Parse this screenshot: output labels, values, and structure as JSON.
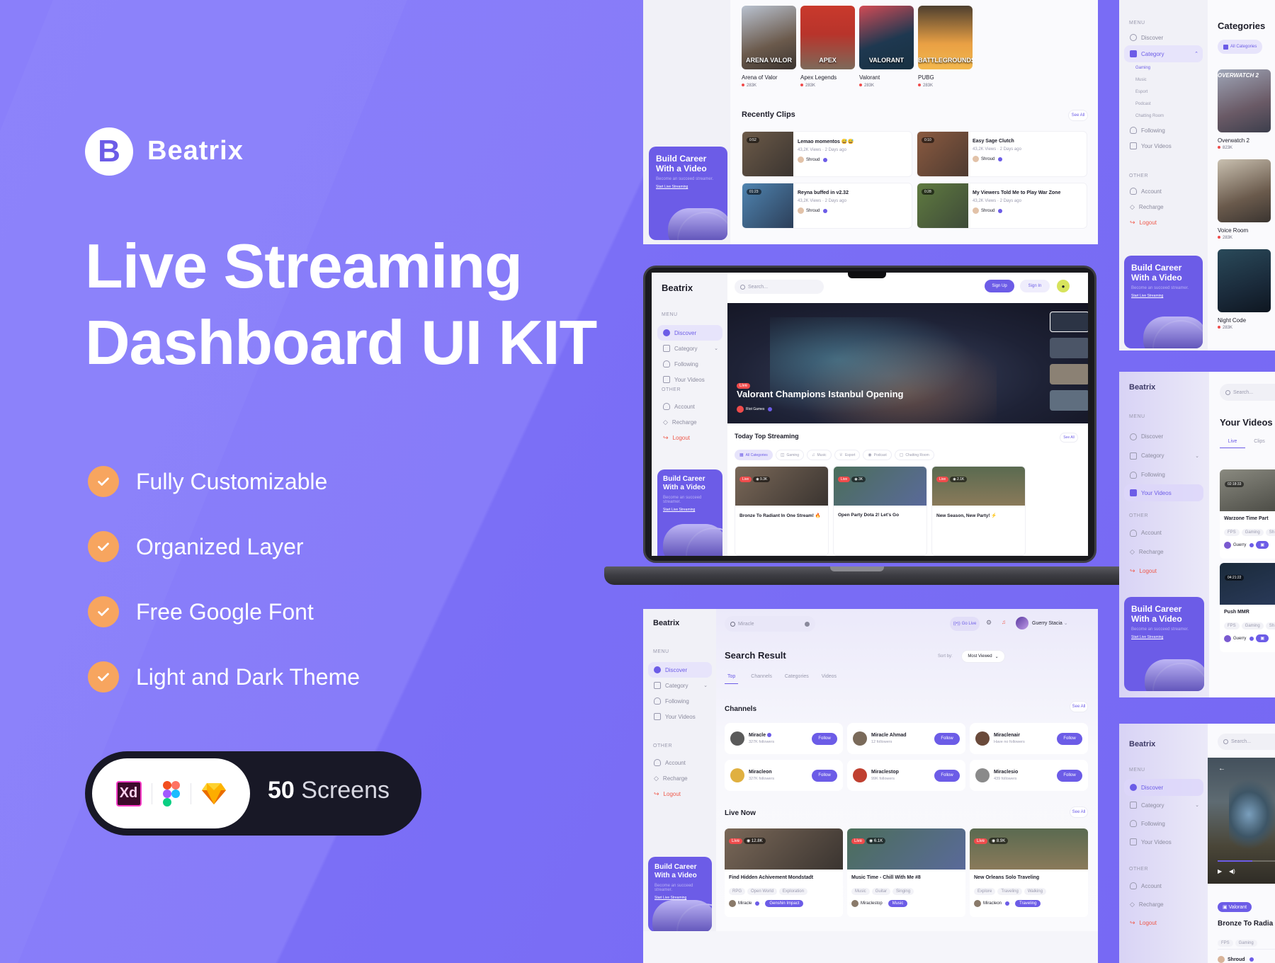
{
  "hero": {
    "logo_letter": "B",
    "brand": "Beatrix",
    "title_line1": "Live Streaming",
    "title_line2": "Dashboard UI KIT",
    "features": [
      "Fully Customizable",
      "Organized Layer",
      "Free Google Font",
      "Light and Dark Theme"
    ],
    "badge": {
      "tools": [
        "Adobe XD",
        "Figma",
        "Sketch"
      ],
      "xd_label": "Xd",
      "count": "50",
      "label": " Screens"
    }
  },
  "colors": {
    "accent": "#6c5ce7",
    "background": "#7c6ff6",
    "check": "#f7a55f",
    "live": "#ef4b4b",
    "badge_bg": "#181826"
  },
  "sidebar": {
    "brand": "Beatrix",
    "menu_label": "MENU",
    "other_label": "OTHER",
    "items": [
      "Discover",
      "Category",
      "Following",
      "Your Videos"
    ],
    "category_sub": [
      "Gaming",
      "Music",
      "Esport",
      "Podcast",
      "Chatting Room"
    ],
    "other_items": [
      "Account",
      "Recharge",
      "Logout"
    ],
    "career": {
      "title1": "Build Career",
      "title2": "With a Video",
      "subtitle": "Become an succeed streamer.",
      "link": "Start Live Streaming"
    }
  },
  "panel_top": {
    "games": [
      {
        "name": "Arena of Valor",
        "viewers": "283K",
        "art": "ARENA VALOR"
      },
      {
        "name": "Apex Legends",
        "viewers": "283K",
        "art": "APEX"
      },
      {
        "name": "Valorant",
        "viewers": "283K",
        "art": "VALORANT"
      },
      {
        "name": "PUBG",
        "viewers": "283K",
        "art": "BATTLEGROUNDS"
      }
    ],
    "clips_title": "Recently Clips",
    "see_all": "See All",
    "clips": [
      {
        "duration": "0:52",
        "title": "Lemao momentos 😅😅",
        "views": "43,2K Views",
        "ago": "2 Days ago",
        "author": "Shroud"
      },
      {
        "duration": "0:10",
        "title": "Easy Sage Clutch",
        "views": "43,2K Views",
        "ago": "2 Days ago",
        "author": "Shroud"
      },
      {
        "duration": "01:23",
        "title": "Reyna buffed in v2.32",
        "views": "43,2K Views",
        "ago": "2 Days ago",
        "author": "Shroud"
      },
      {
        "duration": "0:28",
        "title": "My Viewers Told Me to Play War Zone",
        "views": "43,2K Views",
        "ago": "2 Days ago",
        "author": "Shroud"
      }
    ]
  },
  "laptop": {
    "search_placeholder": "Search...",
    "signup": "Sign Up",
    "signin": "Sign In",
    "hero_live": "Live",
    "hero_title": "Valorant Champions Istanbul Opening",
    "hero_channel": "Riot Games",
    "section_title": "Today Top Streaming",
    "see_all": "See All",
    "categories": [
      "All Categories",
      "Gaming",
      "Music",
      "Esport",
      "Podcast",
      "Chatting Room"
    ],
    "streams": [
      {
        "live": "Live",
        "viewers": "9.3K",
        "title": "Bronze To Radiant In One Stream! 🔥"
      },
      {
        "live": "Live",
        "viewers": "3K",
        "title": "Open Party Dota 2! Let's Go"
      },
      {
        "live": "Live",
        "viewers": "2.1K",
        "title": "New Season, New Party! ⚡"
      }
    ]
  },
  "panel_search": {
    "search_value": "Miracle",
    "go_live": "Go Live",
    "user": "Guerry Stacia",
    "title": "Search Result",
    "sort_label": "Sort by:",
    "sort_value": "Most Viewed",
    "tabs": [
      "Top",
      "Channels",
      "Categories",
      "Videos"
    ],
    "channels_title": "Channels",
    "see_all": "See All",
    "follow": "Follow",
    "channels": [
      {
        "name": "Miracle",
        "followers": "327K followers",
        "verified": true
      },
      {
        "name": "Miracle Ahmad",
        "followers": "12 followers",
        "verified": false
      },
      {
        "name": "Miraclenair",
        "followers": "Have no followers",
        "verified": false
      },
      {
        "name": "Miracleon",
        "followers": "327K followers",
        "verified": false
      },
      {
        "name": "Miraclestop",
        "followers": "99K followers",
        "verified": false
      },
      {
        "name": "Miraclesio",
        "followers": "439 followers",
        "verified": false
      }
    ],
    "live_title": "Live Now",
    "live": [
      {
        "live": "Live",
        "viewers": "12.8K",
        "title": "Find Hidden Achivement Mondstadt",
        "tags": [
          "RPG",
          "Open World",
          "Exploration"
        ],
        "author": "Miracle",
        "category": "Genshin Impact"
      },
      {
        "live": "Live",
        "viewers": "6.1K",
        "title": "Music Time - Chill With Me #8",
        "tags": [
          "Music",
          "Guitar",
          "Singing"
        ],
        "author": "Miraclestop",
        "category": "Music"
      },
      {
        "live": "Live",
        "viewers": "8.9K",
        "title": "New Orleans Solo Traveling",
        "tags": [
          "Explore",
          "Traveling",
          "Walking"
        ],
        "author": "Miracleon",
        "category": "Traveling"
      }
    ]
  },
  "panel_categories": {
    "title": "Categories",
    "chip": "All Categories",
    "items": [
      {
        "name": "Overwatch 2",
        "viewers": "823K",
        "art": "OVERWATCH 2"
      },
      {
        "name": "Voice Room",
        "viewers": "283K"
      },
      {
        "name": "Night Code",
        "viewers": "283K"
      }
    ]
  },
  "panel_videos": {
    "search_placeholder": "Search...",
    "title": "Your Videos",
    "tabs": [
      "Live",
      "Clips"
    ],
    "videos": [
      {
        "duration": "02:18:33",
        "title": "Warzone Time Part",
        "tags": [
          "FPS",
          "Gaming",
          "Sh"
        ],
        "author": "Guerry"
      },
      {
        "duration": "04:21:22",
        "title": "Push MMR",
        "tags": [
          "FPS",
          "Gaming",
          "Sh"
        ],
        "author": "Guerry"
      }
    ]
  },
  "panel_player": {
    "search_placeholder": "Search...",
    "category": "Valorant",
    "title": "Bronze To Radia",
    "tags": [
      "FPS",
      "Gaming"
    ],
    "author": "Shroud",
    "progress": 0.6
  }
}
